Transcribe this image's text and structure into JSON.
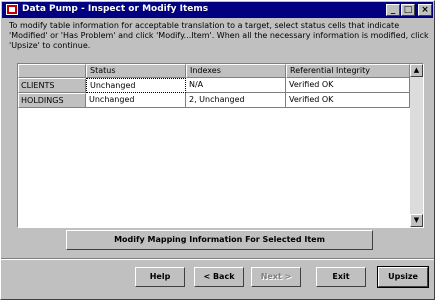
{
  "window": {
    "title": "Data Pump - Inspect or Modify Items",
    "controls": [
      "_",
      "□",
      "×"
    ]
  },
  "instructions": "To modify table information for acceptable translation to a target, select status cells that indicate 'Modified' or 'Has Problem' and click 'Modify...Item'. When all the necessary information is modified, click 'Upsize' to continue.",
  "grid": {
    "columns": [
      "Status",
      "Indexes",
      "Referential Integrity"
    ],
    "rows": [
      {
        "name": "CLIENTS",
        "cells": [
          "Unchanged",
          "N/A",
          "Verified OK"
        ]
      },
      {
        "name": "HOLDINGS",
        "cells": [
          "Unchanged",
          "2, Unchanged",
          "Verified OK"
        ]
      }
    ]
  },
  "modify_button": "Modify Mapping Information For Selected Item",
  "footer": {
    "help": "Help",
    "back": "< Back",
    "next": "Next >",
    "exit": "Exit",
    "upsize": "Upsize"
  }
}
